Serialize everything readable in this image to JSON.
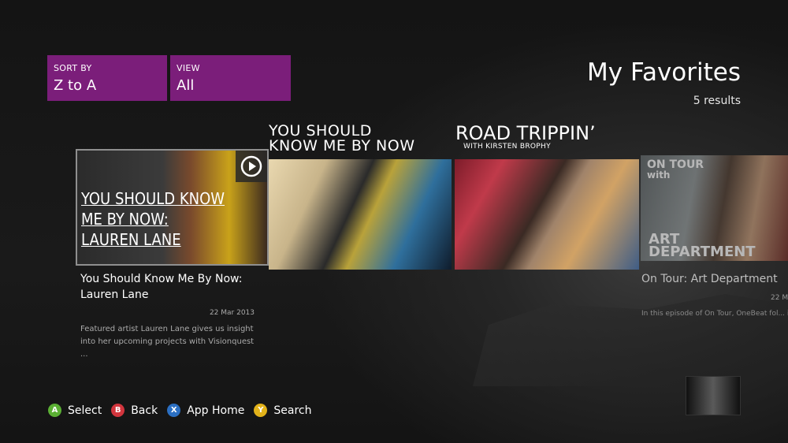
{
  "page": {
    "title": "My Favorites",
    "result_count": "5 results"
  },
  "filters": {
    "sort": {
      "label": "SORT BY",
      "value": "Z to A"
    },
    "view": {
      "label": "VIEW",
      "value": "All"
    }
  },
  "colors": {
    "accent": "#7b1e7a",
    "button_a": "#5bb034",
    "button_b": "#d2353d",
    "button_x": "#2b6fc2",
    "button_y": "#e2b21a"
  },
  "items": [
    {
      "art_line1": "YOU SHOULD KNOW",
      "art_line2": "ME BY NOW:",
      "art_line3": "LAUREN LANE",
      "title": "You Should Know Me By Now: Lauren Lane",
      "date": "22 Mar 2013",
      "description": "Featured artist Lauren Lane gives us insight into her upcoming projects with Visionquest ...",
      "icon": "play-icon"
    },
    {
      "overlay_line1": "YOU SHOULD",
      "overlay_line2": "KNOW ME BY NOW"
    },
    {
      "overlay_title": "ROAD TRIPPIN’",
      "overlay_subtitle": "WITH KIRSTEN BROPHY"
    },
    {
      "art_line1": "ON TOUR",
      "art_line2": "with",
      "art_line3": "ART",
      "art_line4": "DEPARTMENT",
      "title": "On Tour: Art Department",
      "date": "22 M",
      "description": "In this episode of On Tour, OneBeat fol... inspiring Toronto-based duo Art Departm..."
    }
  ],
  "hints": [
    {
      "key": "A",
      "label": "Select"
    },
    {
      "key": "B",
      "label": "Back"
    },
    {
      "key": "X",
      "label": "App Home"
    },
    {
      "key": "Y",
      "label": "Search"
    }
  ]
}
